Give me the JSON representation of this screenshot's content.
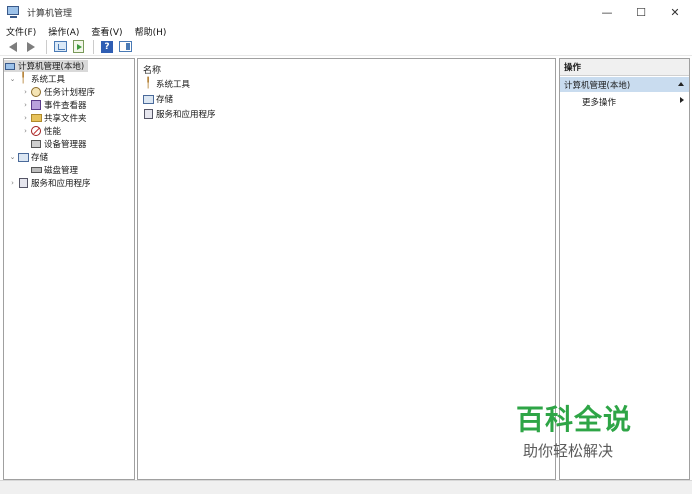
{
  "window": {
    "title": "计算机管理",
    "minimize": "—",
    "maximize": "☐",
    "close": "✕"
  },
  "menu": [
    "文件(F)",
    "操作(A)",
    "查看(V)",
    "帮助(H)"
  ],
  "toolbar": {
    "help_glyph": "?"
  },
  "tree": {
    "root": "计算机管理(本地)",
    "system_tools": "系统工具",
    "task_scheduler": "任务计划程序",
    "event_viewer": "事件查看器",
    "shared_folders": "共享文件夹",
    "performance": "性能",
    "device_manager": "设备管理器",
    "storage": "存储",
    "disk_management": "磁盘管理",
    "services_apps": "服务和应用程序"
  },
  "middle": {
    "column_header": "名称",
    "items": [
      "系统工具",
      "存储",
      "服务和应用程序"
    ]
  },
  "actions": {
    "header": "操作",
    "section": "计算机管理(本地)",
    "more": "更多操作"
  },
  "watermark": {
    "title": "百科全说",
    "subtitle": "助你轻松解决",
    "color": "#2ea546"
  }
}
